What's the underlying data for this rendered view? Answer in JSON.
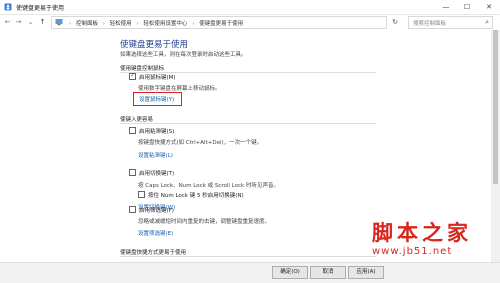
{
  "window": {
    "title": "使键盘更易于使用",
    "minimize": "—",
    "maximize": "☐",
    "close": "✕"
  },
  "address": {
    "back": "←",
    "forward": "→",
    "up": "↑",
    "dropdown": "⌄",
    "crumbs": [
      "控制面板",
      "轻松使用",
      "轻松使用设置中心",
      "使键盘更易于使用"
    ],
    "refresh": "↻",
    "search_placeholder": "搜索控制面板",
    "search_icon": "⌕"
  },
  "page": {
    "title": "使键盘更易于使用",
    "subtitle": "如果选择这些工具，则在每次登录时启动这些工具。",
    "mouse_section": {
      "heading": "使用键盘控制鼠标",
      "option": {
        "label": "启用鼠标键(M)",
        "checked": true
      },
      "description": "使用数字键盘在屏幕上移动鼠标。",
      "link": "设置鼠标键(Y)"
    },
    "typing_section": {
      "heading": "使键入更容易",
      "sticky": {
        "label": "启用粘滞键(S)",
        "checked": false,
        "description": "按键盘快捷方式(如 Ctrl+Alt+Del)，一次一个键。",
        "link": "设置粘滞键(L)"
      },
      "toggle": {
        "label": "启用切换键(T)",
        "checked": false,
        "description": "按 Caps Lock、Num Lock 或 Scroll Lock 时听见声音。",
        "sub_option": {
          "label": "按住 Num Lock 键 5 秒启用切换键(N)",
          "checked": false
        },
        "link": "设置切换键(W)"
      },
      "filter": {
        "label": "启用筛选键(F)",
        "checked": false,
        "description": "忽略或减缓短时间内重复的击键，调整键盘重复速度。",
        "link": "设置筛选键(E)"
      }
    },
    "shortcut_section": {
      "heading": "使键盘快捷方式更易于使用"
    }
  },
  "footer": {
    "ok": "确定(O)",
    "cancel": "取消",
    "apply": "应用(A)"
  },
  "watermark": {
    "title": "脚本之家",
    "url": "www.jb51.net"
  }
}
